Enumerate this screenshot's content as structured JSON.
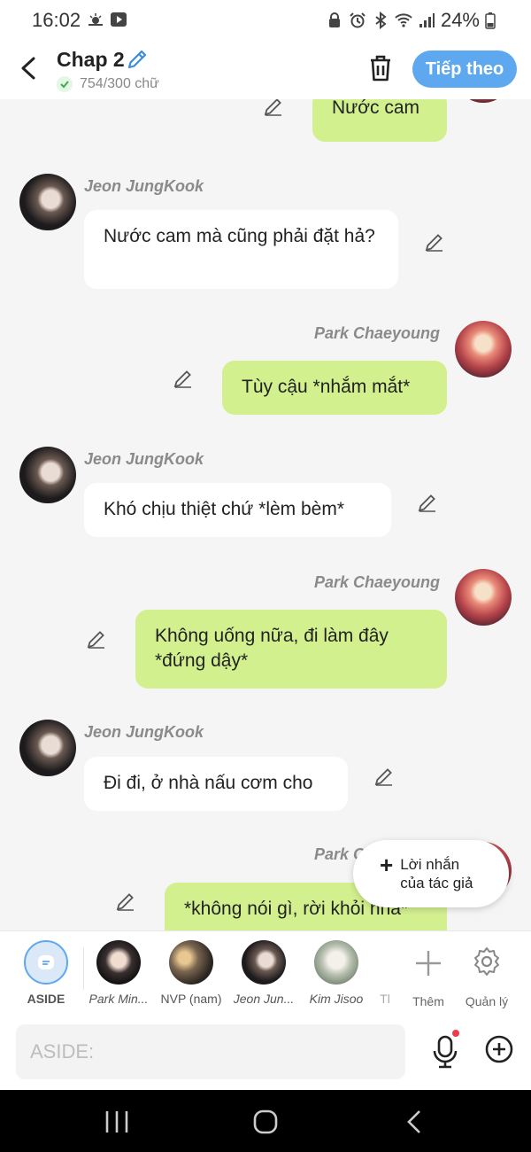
{
  "status_bar": {
    "time": "16:02",
    "battery": "24%"
  },
  "header": {
    "title": "Chap 2",
    "word_count": "754/300 chữ",
    "next_label": "Tiếp theo"
  },
  "messages": [
    {
      "speaker": "",
      "text": "Nước cam",
      "side": "right"
    },
    {
      "speaker": "Jeon JungKook",
      "text": "Nước cam mà cũng phải đặt hả?",
      "side": "left"
    },
    {
      "speaker": "Park Chaeyoung",
      "text": "Tùy cậu *nhắm mắt*",
      "side": "right"
    },
    {
      "speaker": "Jeon JungKook",
      "text": "Khó chịu thiệt chứ *lèm bèm*",
      "side": "left"
    },
    {
      "speaker": "Park Chaeyoung",
      "text": "Không uống nữa, đi làm đây *đứng dậy*",
      "side": "right"
    },
    {
      "speaker": "Jeon JungKook",
      "text": "Đi đi, ở nhà nấu cơm cho",
      "side": "left"
    },
    {
      "speaker": "Park C",
      "text": "*không nói gì, rời khỏi nha*",
      "side": "right"
    }
  ],
  "author_note": {
    "line1": "Lời nhắn",
    "line2": "của tác giả"
  },
  "characters": [
    {
      "label": "ASIDE"
    },
    {
      "label": "Park Min..."
    },
    {
      "label": "NVP (nam)"
    },
    {
      "label": "Jeon Jun..."
    },
    {
      "label": "Kim Jisoo"
    },
    {
      "label": "Tl"
    }
  ],
  "tools": {
    "add_label": "Thêm",
    "manage_label": "Quản lý"
  },
  "input": {
    "placeholder": "ASIDE:"
  },
  "colors": {
    "accent": "#5ea8f0",
    "bubble_green": "#d3f08f",
    "bubble_white": "#ffffff",
    "background": "#f5f5f5"
  }
}
